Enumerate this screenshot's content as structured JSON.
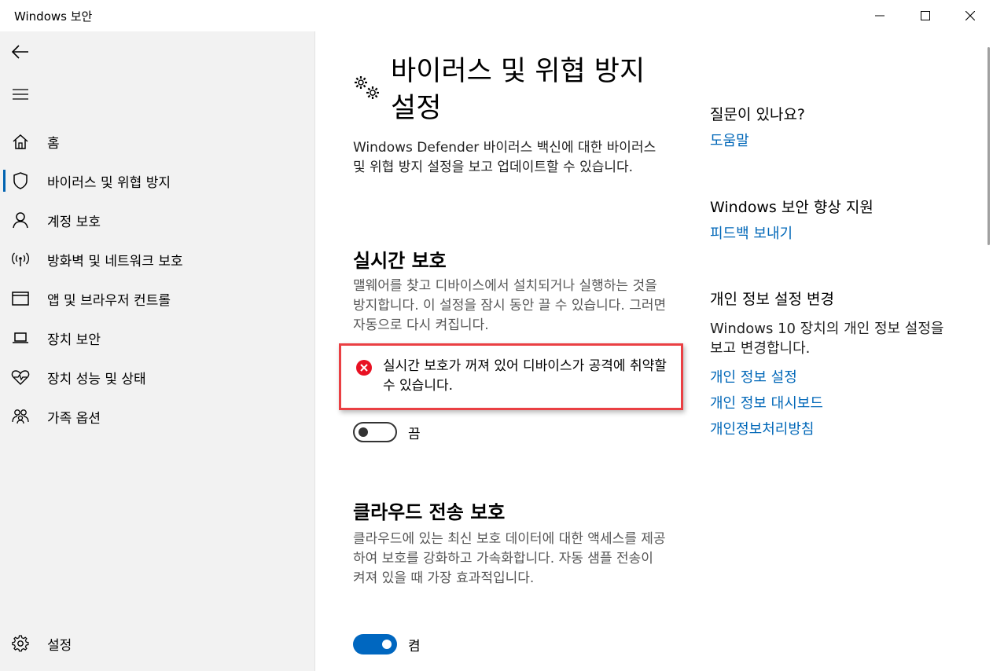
{
  "window": {
    "title": "Windows 보안"
  },
  "sidebar": {
    "items": [
      {
        "label": "홈"
      },
      {
        "label": "바이러스 및 위협 방지"
      },
      {
        "label": "계정 보호"
      },
      {
        "label": "방화벽 및 네트워크 보호"
      },
      {
        "label": "앱 및 브라우저 컨트롤"
      },
      {
        "label": "장치 보안"
      },
      {
        "label": "장치 성능 및 상태"
      },
      {
        "label": "가족 옵션"
      }
    ],
    "settings_label": "설정"
  },
  "main": {
    "title": "바이러스 및 위협 방지 설정",
    "description": "Windows Defender 바이러스 백신에 대한 바이러스 및 위협 방지 설정을 보고 업데이트할 수 있습니다.",
    "realtime": {
      "title": "실시간 보호",
      "description": "맬웨어를 찾고 디바이스에서 설치되거나 실행하는 것을 방지합니다. 이 설정을 잠시 동안 끌 수 있습니다. 그러면 자동으로 다시 켜집니다.",
      "alert": "실시간 보호가 꺼져 있어 디바이스가 공격에 취약할 수 있습니다.",
      "toggle_label": "끔"
    },
    "cloud": {
      "title": "클라우드 전송 보호",
      "description": "클라우드에 있는 최신 보호 데이터에 대한 액세스를 제공하여 보호를 강화하고 가속화합니다. 자동 샘플 전송이 켜져 있을 때 가장 효과적입니다.",
      "toggle_label": "켬"
    }
  },
  "right": {
    "question_heading": "질문이 있나요?",
    "help_link": "도움말",
    "improve_heading": "Windows 보안 향상 지원",
    "feedback_link": "피드백 보내기",
    "privacy_heading": "개인 정보 설정 변경",
    "privacy_text": "Windows 10 장치의 개인 정보 설정을 보고 변경합니다.",
    "privacy_links": [
      "개인 정보 설정",
      "개인 정보 대시보드",
      "개인정보처리방침"
    ]
  },
  "colors": {
    "accent": "#0067c0",
    "link": "#0067b8",
    "alert_red": "#e81123",
    "highlight_border": "#ea3f43"
  }
}
